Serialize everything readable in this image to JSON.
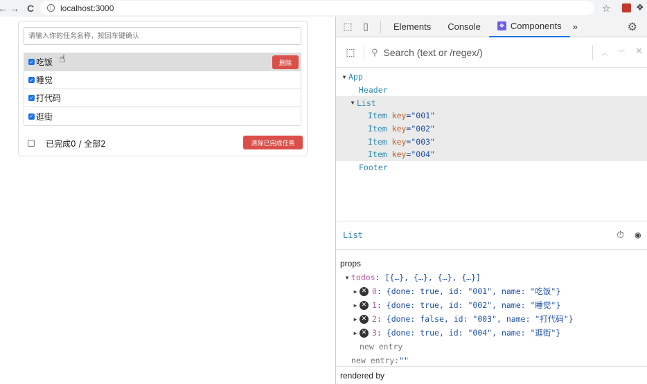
{
  "browser": {
    "back_icon": "←",
    "forward_icon": "→",
    "reload_icon": "C",
    "url": "localhost:3000",
    "info_icon": "i",
    "star_icon": "☆",
    "puzzle_icon": "❖"
  },
  "app": {
    "input_placeholder": "请输入你的任务名称，按回车键确认",
    "todos": [
      {
        "name": "吃饭"
      },
      {
        "name": "睡觉"
      },
      {
        "name": "打代码"
      },
      {
        "name": "逛街"
      }
    ],
    "delete_label": "删除",
    "footer_text": "已完成0 / 全部2",
    "clear_label": "清除已完成任务",
    "checkmark": "✓"
  },
  "devtools": {
    "tabs": {
      "elements": "Elements",
      "console": "Console",
      "components": "Components",
      "more": "»"
    },
    "search_placeholder": "Search (text or /regex/)",
    "tree": {
      "app": "App",
      "header": "Header",
      "list": "List",
      "item_label": "Item",
      "key_attr": "key",
      "keys": [
        "=\"001\"",
        "=\"002\"",
        "=\"003\"",
        "=\"004\""
      ],
      "footer": "Footer"
    },
    "selected_component": "List",
    "props_title": "props",
    "todos_key": "todos",
    "todos_summary": ": [{…}, {…}, {…}, {…}]",
    "prop_rows": [
      {
        "index": "0",
        "value": ": {done: true, id: \"001\", name: \"吃饭\"}"
      },
      {
        "index": "1",
        "value": ": {done: true, id: \"002\", name: \"睡觉\"}"
      },
      {
        "index": "2",
        "value": ": {done: false, id: \"003\", name: \"打代码\"}"
      },
      {
        "index": "3",
        "value": ": {done: true, id: \"004\", name: \"逛街\"}"
      }
    ],
    "new_entry": "new entry",
    "new_entry_label": "new entry: ",
    "new_entry_value": "\"\"",
    "rendered_by": "rendered by"
  }
}
